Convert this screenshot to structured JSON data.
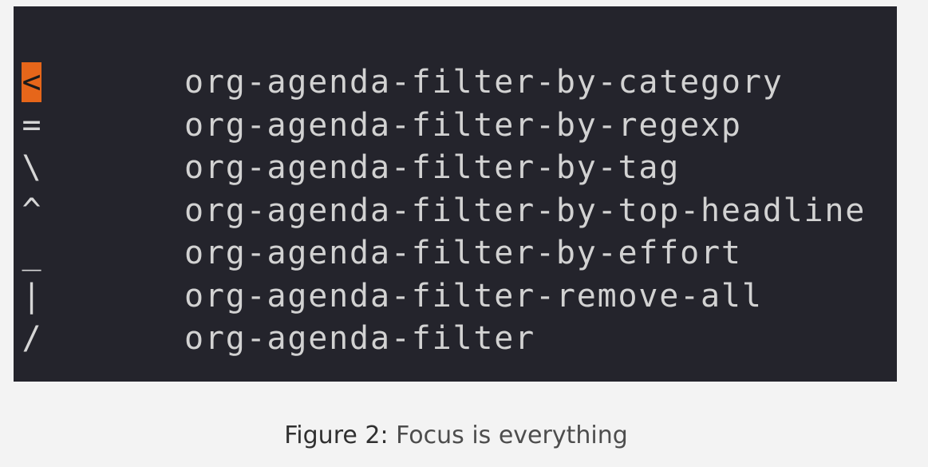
{
  "terminal": {
    "rows": [
      {
        "key": "<",
        "command": "org-agenda-filter-by-category"
      },
      {
        "key": "=",
        "command": "org-agenda-filter-by-regexp"
      },
      {
        "key": "\\",
        "command": "org-agenda-filter-by-tag"
      },
      {
        "key": "^",
        "command": "org-agenda-filter-by-top-headline"
      },
      {
        "key": "_",
        "command": "org-agenda-filter-by-effort"
      },
      {
        "key": "|",
        "command": "org-agenda-filter-remove-all"
      },
      {
        "key": "/",
        "command": "org-agenda-filter"
      }
    ]
  },
  "caption": {
    "label": "Figure 2:",
    "text": "Focus is everything"
  },
  "colors": {
    "terminal_background": "#24242c",
    "cursor": "#e6661a",
    "text": "#d2d2d2"
  }
}
